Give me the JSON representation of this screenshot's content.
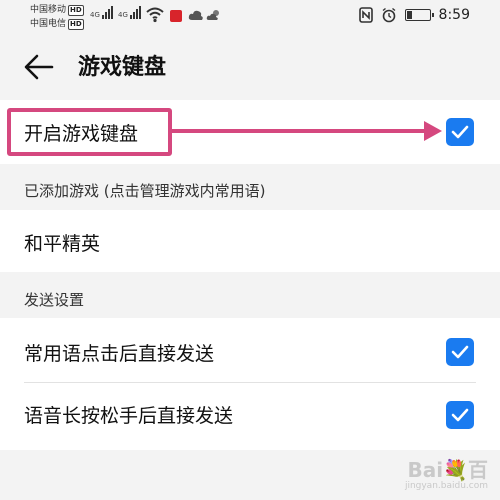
{
  "status_bar": {
    "carrier1": "中国移动",
    "carrier2": "中国电信",
    "hd_badge": "HD",
    "signal1_label": "4G",
    "signal2_label": "4G",
    "time": "8:59"
  },
  "toolbar": {
    "title": "游戏键盘"
  },
  "settings": {
    "enable_label": "开启游戏键盘",
    "enable_checked": true,
    "added_games_header": "已添加游戏 (点击管理游戏内常用语)",
    "game_name": "和平精英",
    "send_header": "发送设置",
    "send_after_tap_label": "常用语点击后直接发送",
    "send_after_tap_checked": true,
    "voice_release_label": "语音长按松手后直接发送",
    "voice_release_checked": true
  },
  "annotation": {
    "color": "#d5487f"
  },
  "accent_color": "#1a7bf0",
  "watermark": {
    "main": "Bai💐百",
    "sub": "jingyan.baidu.com"
  }
}
